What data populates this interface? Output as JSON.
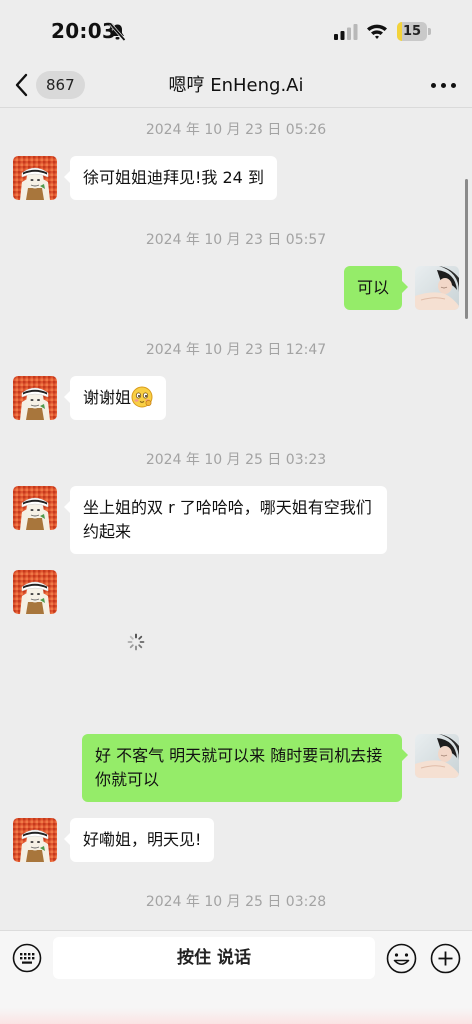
{
  "status_bar": {
    "time": "20:03",
    "battery": "15",
    "battery_level": 0.15,
    "icons": [
      "bell-off-icon",
      "signal-icon",
      "wifi-icon",
      "battery-icon"
    ]
  },
  "nav": {
    "unread_count": "867",
    "title": "嗯哼 EnHeng.Ai",
    "icons": [
      "chevron-left-icon",
      "more-icon"
    ]
  },
  "messages": [
    {
      "type": "timestamp",
      "text": "2024 年 10 月 23 日 05:26"
    },
    {
      "type": "incoming",
      "text": "徐可姐姐迪拜见!我 24 到"
    },
    {
      "type": "timestamp",
      "text": "2024 年 10 月 23 日 05:57"
    },
    {
      "type": "outgoing",
      "text": "可以"
    },
    {
      "type": "timestamp",
      "text": "2024 年 10 月 23 日 12:47"
    },
    {
      "type": "incoming",
      "text": "谢谢姐",
      "emoji": "shy-face-emoji"
    },
    {
      "type": "timestamp",
      "text": "2024 年 10 月 25 日 03:23"
    },
    {
      "type": "incoming",
      "text": "坐上姐的双 r 了哈哈哈，哪天姐有空我们约起来"
    },
    {
      "type": "incoming",
      "text": "",
      "status": "loading"
    },
    {
      "type": "outgoing",
      "text": "好 不客气 明天就可以来 随时要司机去接你就可以"
    },
    {
      "type": "incoming",
      "text": "好嘞姐，明天见!"
    },
    {
      "type": "timestamp",
      "text": "2024 年 10 月 25 日 03:28"
    }
  ],
  "input_bar": {
    "hold_to_talk": "按住 说话",
    "icons": [
      "keyboard-icon",
      "emoji-icon",
      "plus-icon"
    ]
  },
  "colors": {
    "background": "#ededed",
    "incoming_bubble": "#ffffff",
    "outgoing_bubble": "#95ec69",
    "timestamp_text": "#a3a3a3",
    "battery_fill": "#f3d33a"
  }
}
